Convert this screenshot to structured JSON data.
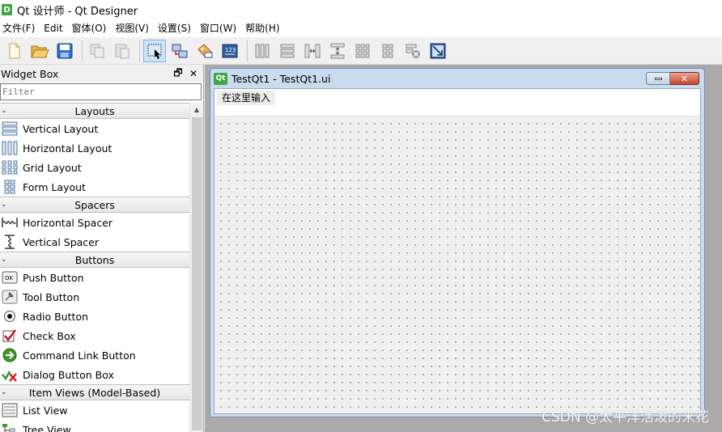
{
  "window": {
    "title": "Qt 设计师 - Qt Designer",
    "icon_letter": "D"
  },
  "menubar": {
    "items": [
      "文件(F)",
      "Edit",
      "窗体(O)",
      "视图(V)",
      "设置(S)",
      "窗口(W)",
      "帮助(H)"
    ]
  },
  "toolbar": {
    "groups": [
      [
        "new-file-icon",
        "open-folder-icon",
        "save-icon"
      ],
      [
        "copy-icon",
        "paste-icon"
      ],
      [
        "edit-widgets-icon",
        "edit-signals-slots-icon",
        "edit-buddies-icon",
        "edit-tab-order-icon"
      ],
      [
        "layout-horizontal-icon",
        "layout-vertical-icon",
        "layout-horizontal-splitter-icon",
        "layout-vertical-splitter-icon",
        "layout-grid-icon",
        "layout-form-icon",
        "break-layout-icon",
        "adjust-size-icon"
      ]
    ],
    "selected": "edit-widgets-icon"
  },
  "widget_box": {
    "title": "Widget Box",
    "float_glyph": "🗗",
    "close_glyph": "✕",
    "filter_placeholder": "Filter",
    "categories": [
      {
        "label": "Layouts",
        "items": [
          {
            "label": "Vertical Layout",
            "icon": "vertical-layout-icon"
          },
          {
            "label": "Horizontal Layout",
            "icon": "horizontal-layout-icon"
          },
          {
            "label": "Grid Layout",
            "icon": "grid-layout-icon"
          },
          {
            "label": "Form Layout",
            "icon": "form-layout-icon"
          }
        ]
      },
      {
        "label": "Spacers",
        "items": [
          {
            "label": "Horizontal Spacer",
            "icon": "horizontal-spacer-icon"
          },
          {
            "label": "Vertical Spacer",
            "icon": "vertical-spacer-icon"
          }
        ]
      },
      {
        "label": "Buttons",
        "items": [
          {
            "label": "Push Button",
            "icon": "push-button-icon"
          },
          {
            "label": "Tool Button",
            "icon": "tool-button-icon"
          },
          {
            "label": "Radio Button",
            "icon": "radio-button-icon"
          },
          {
            "label": "Check Box",
            "icon": "check-box-icon"
          },
          {
            "label": "Command Link Button",
            "icon": "command-link-icon"
          },
          {
            "label": "Dialog Button Box",
            "icon": "dialog-button-box-icon"
          }
        ]
      },
      {
        "label": "Item Views (Model-Based)",
        "items": [
          {
            "label": "List View",
            "icon": "list-view-icon"
          },
          {
            "label": "Tree View",
            "icon": "tree-view-icon"
          }
        ]
      }
    ]
  },
  "subwindow": {
    "title": "TestQt1 - TestQt1.ui",
    "icon_text": "Qt",
    "close_glyph": "✕",
    "menu_placeholder": "在这里输入"
  },
  "watermark": "CSDN @太平洋活泼的米花"
}
